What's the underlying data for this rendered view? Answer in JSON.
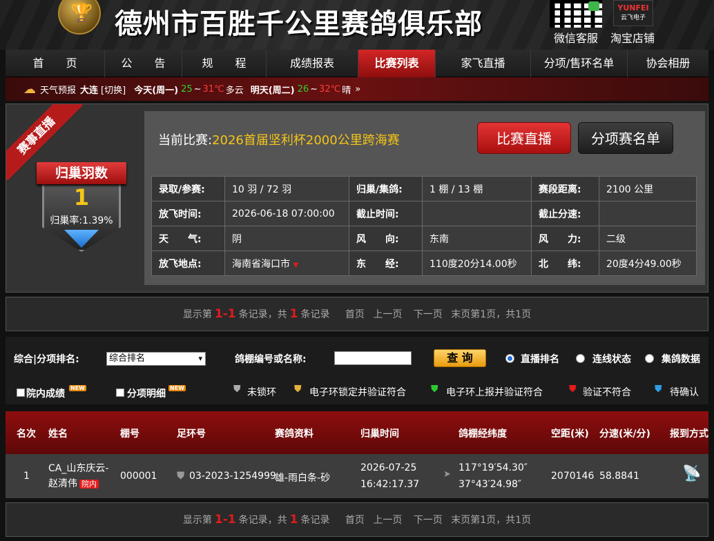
{
  "header": {
    "title": "德州市百胜千公里赛鸽俱乐部",
    "wechat_label": "微信客服",
    "taobao_label": "淘宝店铺",
    "store_brand": "YUNFEI",
    "store_sub": "云飞电子"
  },
  "nav": {
    "items": [
      "首　　页",
      "公　　告",
      "规　　程",
      "成绩报表",
      "比赛列表",
      "家飞直播",
      "分项/售环名单",
      "协会相册"
    ],
    "active_index": 4
  },
  "weather": {
    "label": "天气预报",
    "city": "大连",
    "switch": "[切换]",
    "today_label": "今天(周一)",
    "today_low": "25",
    "today_tilde": "~",
    "today_high": "31℃",
    "today_desc": "多云",
    "tomorrow_label": "明天(周二)",
    "tomorrow_low": "26",
    "tomorrow_high": "32℃",
    "tomorrow_desc": "晴",
    "more": "»"
  },
  "race": {
    "ribbon": "赛事直播",
    "shield_title": "归巢羽数",
    "shield_count": "1",
    "shield_rate": "归巢率:1.39%",
    "current_label": "当前比赛:",
    "current_name": "2026首届坚利杯2000公里跨海赛",
    "btn_live": "比赛直播",
    "btn_list": "分项赛名单",
    "rows": [
      [
        [
          "录取/参赛:",
          "10 羽 / 72 羽"
        ],
        [
          "归巢/集鸽:",
          "1 棚 / 13 棚"
        ],
        [
          "赛段距离:",
          "2100 公里"
        ]
      ],
      [
        [
          "放飞时间:",
          "2026-06-18 07:00:00"
        ],
        [
          "截止时间:",
          ""
        ],
        [
          "截止分速:",
          ""
        ]
      ],
      [
        [
          "天　　气:",
          "阴"
        ],
        [
          "风　　向:",
          "东南"
        ],
        [
          "风　　力:",
          "二级"
        ]
      ],
      [
        [
          "放飞地点:",
          "海南省海口市"
        ],
        [
          "东　　经:",
          "110度20分14.00秒"
        ],
        [
          "北　　纬:",
          "20度4分49.00秒"
        ]
      ]
    ]
  },
  "pager": {
    "show": "显示第",
    "range": "1-1",
    "records_total": "条记录，共",
    "total": "1",
    "records": "条记录",
    "first": "首页",
    "prev": "上一页",
    "next": "下一页",
    "last": "末页",
    "page_info": "第1页，共1页"
  },
  "filter": {
    "rank_label": "综合|分项排名:",
    "rank_value": "综合排名",
    "loft_label": "鸽棚编号或名称:",
    "query_button": "查 询",
    "radio_live": "直播排名",
    "radio_online": "连线状态",
    "radio_collect": "集鸽数据",
    "cb_inner": "院内成绩",
    "cb_detail": "分项明细",
    "new_badge": "NEW",
    "legend_unlocked": "未锁环",
    "legend_locked": "电子环锁定并验证符合",
    "legend_reported": "电子环上报并验证符合",
    "legend_invalid": "验证不符合",
    "legend_pending": "待确认"
  },
  "results": {
    "headers": [
      "名次",
      "姓名",
      "棚号",
      "足环号",
      "赛鸽资料",
      "归巢时间",
      "鸽棚经纬度",
      "空距(米)",
      "分速(米/分)",
      "报到方式"
    ],
    "rows": [
      {
        "rank": "1",
        "name_line1": "CA_山东庆云-",
        "name_line2": "赵清伟",
        "tag": "院内",
        "loft": "000001",
        "ring": "03-2023-1254999",
        "info": "雄-雨白条-砂",
        "time_date": "2026-07-25",
        "time_clock": "16:42:17.37",
        "lng": "117°19′54.30″",
        "lat": "37°43′24.98″",
        "distance": "2070146",
        "speed": "58.8841"
      }
    ]
  }
}
